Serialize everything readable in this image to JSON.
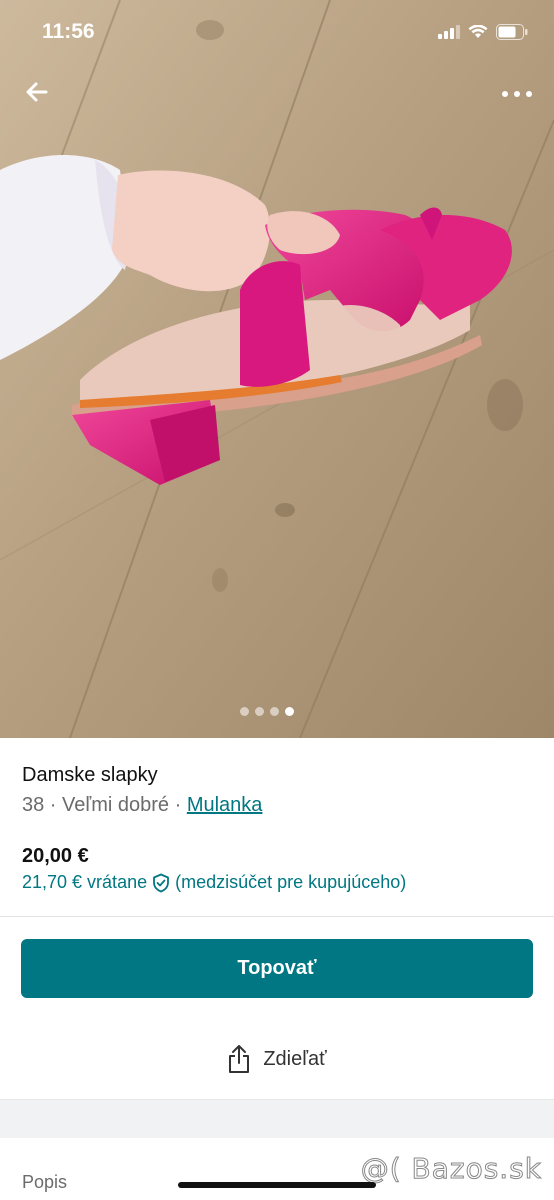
{
  "status": {
    "time": "11:56"
  },
  "gallery": {
    "photo_count": 4,
    "active_index": 4
  },
  "item": {
    "title": "Damske slapky",
    "size": "38",
    "separator": " · ",
    "condition": "Veľmi dobré",
    "seller": "Mulanka",
    "price": "20,00 €",
    "price_incl_amount": "21,70 € vrátane",
    "price_incl_note": "(medzisúčet pre kupujúceho)"
  },
  "actions": {
    "bump_label": "Topovať",
    "share_label": "Zdieľať"
  },
  "section": {
    "description_label": "Popis"
  },
  "watermark": "@( Bazos.sk",
  "colors": {
    "accent": "#007782",
    "shoe": "#e0157f"
  },
  "icons": {
    "back": "arrow-left-icon",
    "more": "ellipsis-horizontal-icon",
    "shield": "shield-check-icon",
    "share": "share-icon"
  }
}
